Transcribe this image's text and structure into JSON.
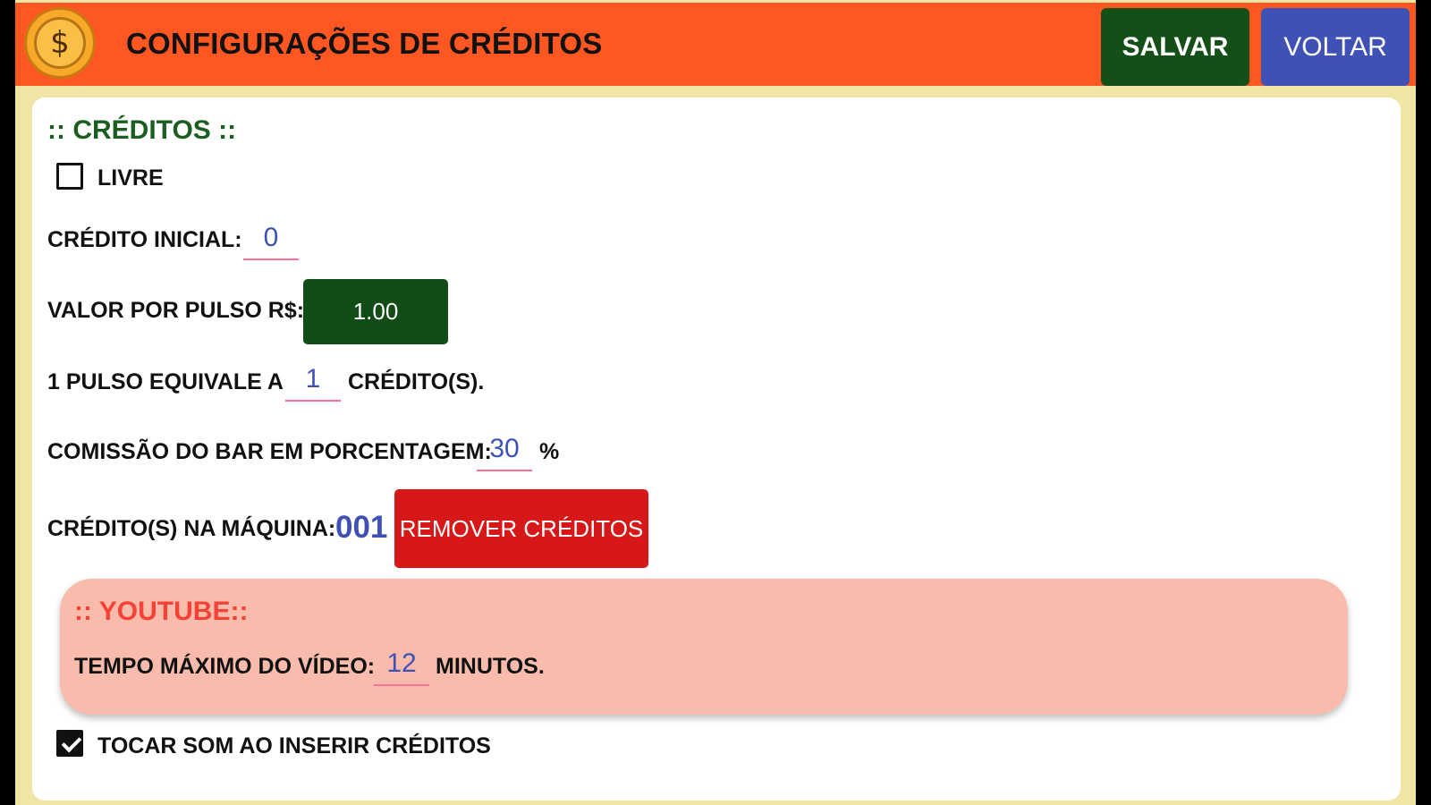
{
  "header": {
    "icon": "coin-dollar-icon",
    "title": "CONFIGURAÇÕES DE CRÉDITOS",
    "save_label": "SALVAR",
    "back_label": "VOLTAR"
  },
  "creditos": {
    "section_title": ":: CRÉDITOS ::",
    "livre": {
      "label": "LIVRE",
      "checked": false
    },
    "credito_inicial": {
      "label": "CRÉDITO INICIAL:",
      "value": "0"
    },
    "valor_por_pulso": {
      "label": "VALOR POR PULSO R$:",
      "value": "1.00"
    },
    "pulso": {
      "label_before": "1 PULSO EQUIVALE A",
      "value": "1",
      "label_after": "CRÉDITO(S)."
    },
    "comissao": {
      "label": "COMISSÃO DO BAR EM PORCENTAGEM:",
      "value": "30",
      "unit": "%"
    },
    "maquina": {
      "label": "CRÉDITO(S) NA MÁQUINA:",
      "value": "001",
      "remove_label": "REMOVER CRÉDITOS"
    }
  },
  "youtube": {
    "section_title": ":: YOUTUBE::",
    "tempo": {
      "label": "TEMPO MÁXIMO DO VÍDEO:",
      "value": "12",
      "unit": "MINUTOS."
    }
  },
  "som": {
    "label": "TOCAR SOM AO INSERIR CRÉDITOS",
    "checked": true
  },
  "colors": {
    "header": "#ff5722",
    "save": "#134f17",
    "back": "#3f51b5",
    "remove": "#d61818",
    "youtube_panel": "#f9bcac",
    "field_value": "#3f51b5"
  }
}
